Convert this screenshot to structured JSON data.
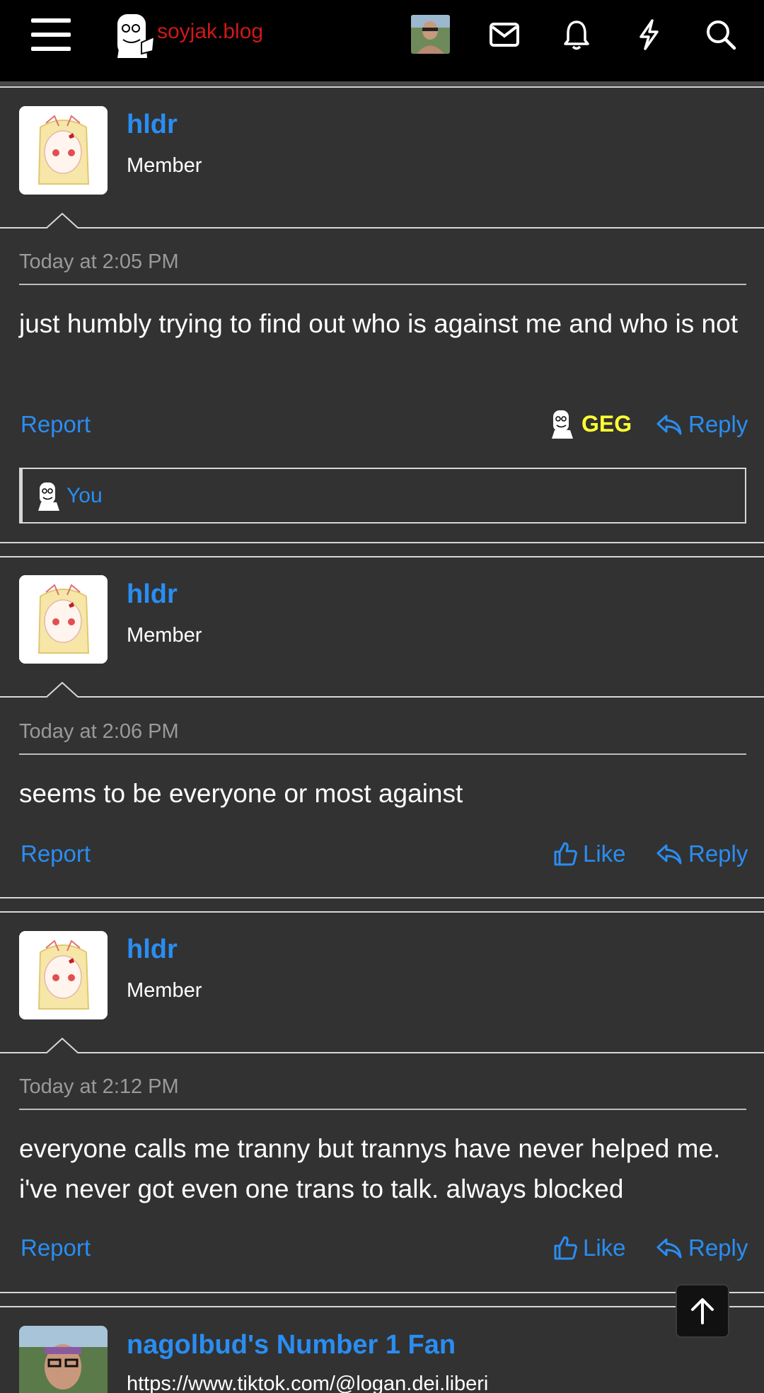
{
  "header": {
    "site_name": "soyjak.blog",
    "icons": [
      "menu-icon",
      "user-avatar",
      "envelope-icon",
      "bell-icon",
      "bolt-icon",
      "search-icon"
    ],
    "brand_color": "#d01818"
  },
  "posts": [
    {
      "username": "hldr",
      "user_title": "Member",
      "timestamp": "Today at 2:05 PM",
      "message": "just humbly trying to find out who is against me and who is not",
      "report_label": "Report",
      "reaction_label": "GEG",
      "reply_label": "Reply",
      "liked_by": "You"
    },
    {
      "username": "hldr",
      "user_title": "Member",
      "timestamp": "Today at 2:06 PM",
      "message": "seems to be everyone or most against",
      "report_label": "Report",
      "like_label": "Like",
      "reply_label": "Reply"
    },
    {
      "username": "hldr",
      "user_title": "Member",
      "timestamp": "Today at 2:12 PM",
      "message": "everyone calls me tranny but trannys have never helped me. i've never got even one trans to talk. always blocked",
      "report_label": "Report",
      "like_label": "Like",
      "reply_label": "Reply"
    },
    {
      "username": "nagolbud's Number 1 Fan",
      "user_title": "https://www.tiktok.com/@logan.dei.liberi"
    }
  ],
  "colors": {
    "link": "#2a8df2",
    "reaction": "#ffff33",
    "background": "#323232"
  }
}
